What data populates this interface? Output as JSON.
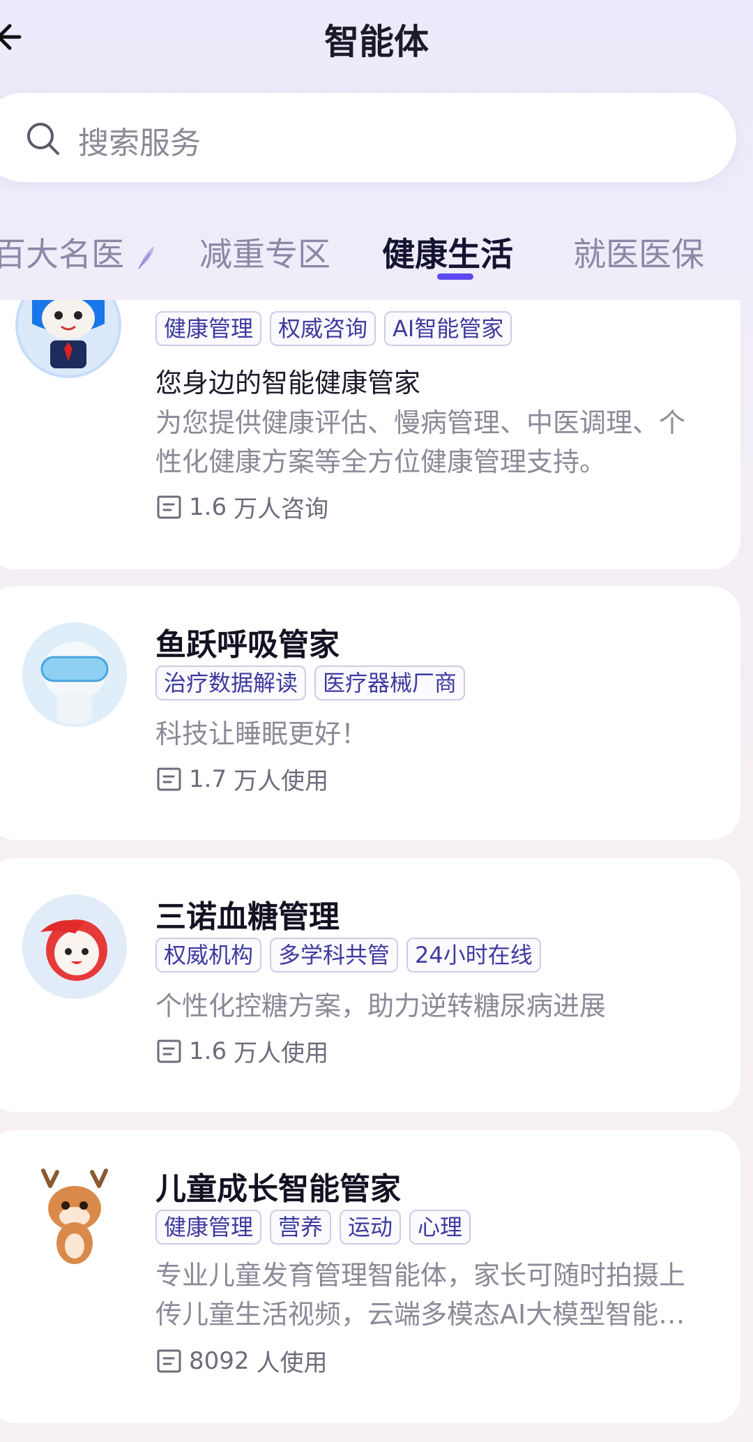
{
  "header": {
    "title": "智能体"
  },
  "search": {
    "placeholder": "搜索服务"
  },
  "tabs": [
    {
      "label": "百大名医",
      "active": false
    },
    {
      "label": "减重专区",
      "active": false
    },
    {
      "label": "健康生活",
      "active": true
    },
    {
      "label": "就医医保",
      "active": false
    }
  ],
  "cards": [
    {
      "subtitle": "您身边的智能健康管家",
      "tags": [
        "健康管理",
        "权威咨询",
        "AI智能管家"
      ],
      "description": "为您提供健康评估、慢病管理、中医调理、个性化健康方案等全方位健康管理支持。",
      "stat_number": "1.6",
      "stat_text": "万人咨询"
    },
    {
      "title": "鱼跃呼吸管家",
      "tags": [
        "治疗数据解读",
        "医疗器械厂商"
      ],
      "description": "科技让睡眠更好！",
      "stat_number": "1.7",
      "stat_text": "万人使用"
    },
    {
      "title": "三诺血糖管理",
      "tags": [
        "权威机构",
        "多学科共管",
        "24小时在线"
      ],
      "description": "个性化控糖方案，助力逆转糖尿病进展",
      "stat_number": "1.6",
      "stat_text": "万人使用"
    },
    {
      "title": "儿童成长智能管家",
      "tags": [
        "健康管理",
        "营养",
        "运动",
        "心理"
      ],
      "description": "专业儿童发育管理智能体，家长可随时拍摄上传儿童生活视频，云端多模态AI大模型智能…",
      "stat_number": "8092",
      "stat_text": "人使用"
    }
  ],
  "colors": {
    "accent": "#5b48f0",
    "tag_text": "#3e3a9e",
    "tag_border": "#cfcbe6"
  }
}
